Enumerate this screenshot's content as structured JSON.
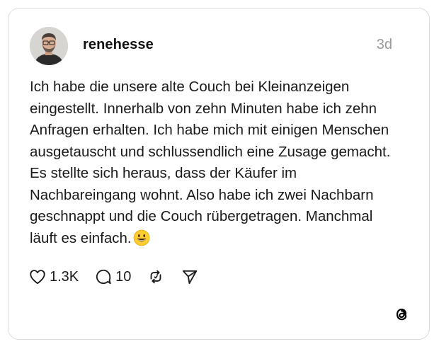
{
  "post": {
    "username": "renehesse",
    "timestamp": "3d",
    "text": "Ich habe die unsere alte Couch bei Kleinanzeigen eingestellt. Innerhalb von zehn Minuten habe ich zehn Anfragen erhalten. Ich habe mich mit einigen Menschen ausgetauscht und schlussendlich eine Zusage gemacht. Es stellte sich heraus, dass der Käufer im Nachbareingang wohnt. Also habe ich zwei Nachbarn geschnappt und die Couch rübergetragen. Manchmal läuft es einfach.",
    "emoji": "grinning-face"
  },
  "actions": {
    "likes": "1.3K",
    "replies": "10",
    "repost_icon": "repost-icon",
    "share_icon": "send-icon"
  },
  "footer": {
    "logo_icon": "threads-logo-icon"
  },
  "colors": {
    "text": "#1a1a1a",
    "muted": "#9a9a9a",
    "border": "#dcdcdc"
  }
}
